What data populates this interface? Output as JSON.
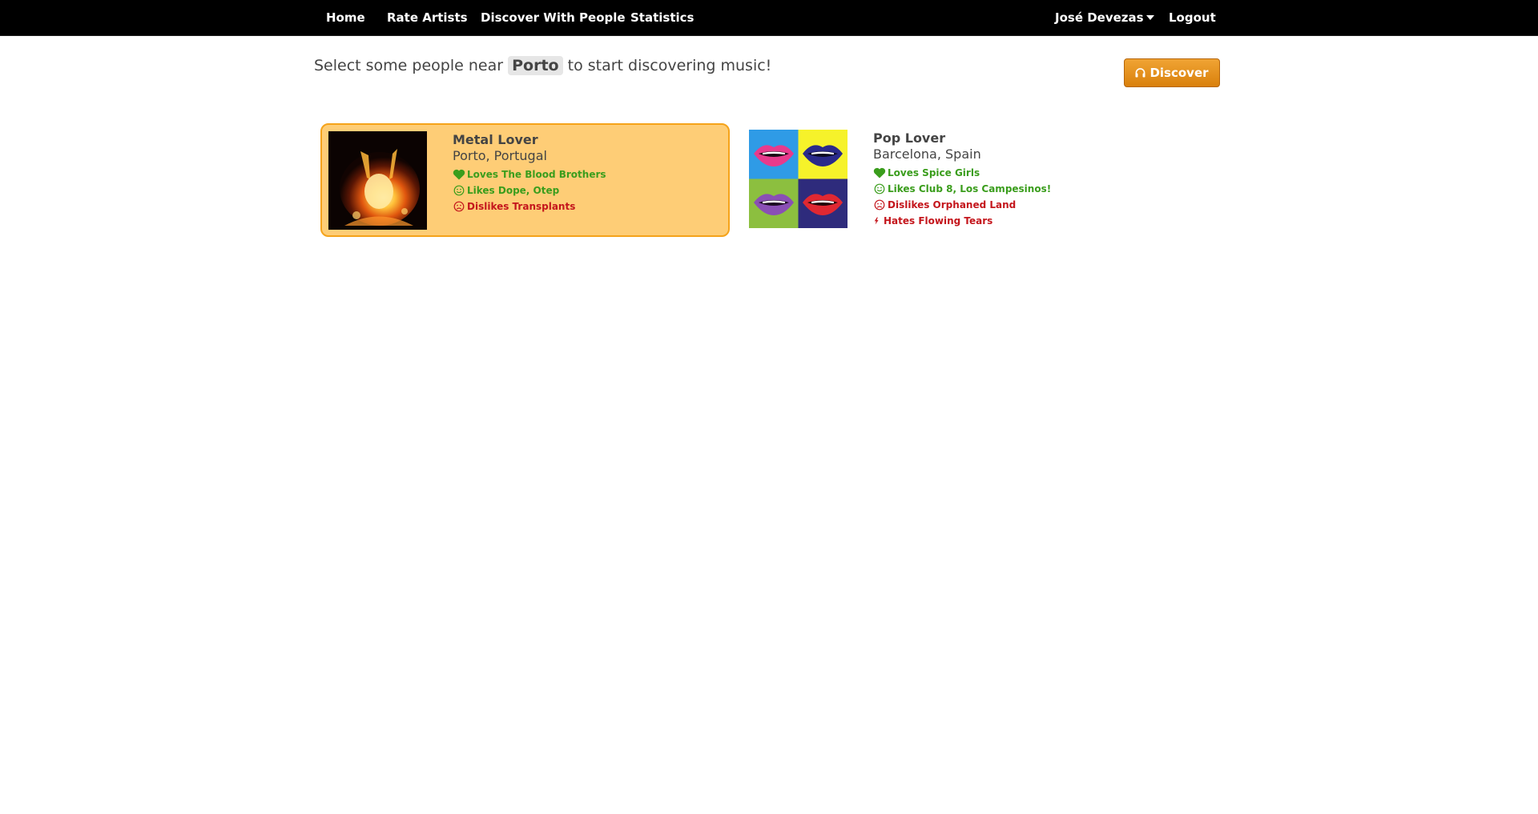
{
  "nav": {
    "home": "Home",
    "rate_artists": "Rate Artists",
    "discover_with_people": "Discover With People",
    "statistics": "Statistics",
    "user": "José Devezas",
    "logout": "Logout"
  },
  "intro": {
    "before": "Select some people near",
    "city": "Porto",
    "after": "to start discovering music!"
  },
  "discover_button": "Discover",
  "people": [
    {
      "name": "Metal Lover",
      "location": "Porto, Portugal",
      "selected": true,
      "loves": "Loves The Blood Brothers",
      "likes": "Likes Dope, Otep",
      "dislikes": "Dislikes Transplants"
    },
    {
      "name": "Pop Lover",
      "location": "Barcelona, Spain",
      "selected": false,
      "loves": "Loves Spice Girls",
      "likes": "Likes Club 8, Los Campesinos!",
      "dislikes": "Dislikes Orphaned Land",
      "hates": "Hates Flowing Tears"
    }
  ],
  "colors": {
    "navbar": "#000000",
    "accent_orange": "#e8900f",
    "selected_card": "#fecd76",
    "positive": "#3a9d1c",
    "negative": "#c4161c"
  }
}
